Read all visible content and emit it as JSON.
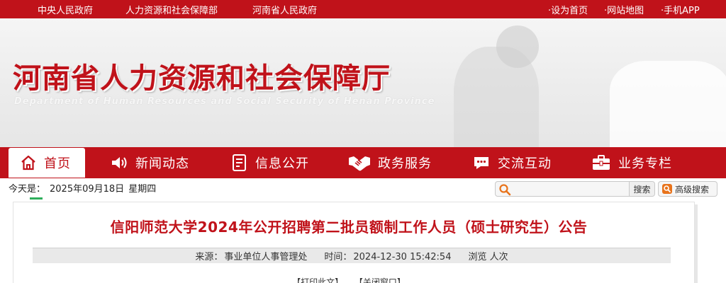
{
  "topbar": {
    "left_links": [
      "中央人民政府",
      "人力资源和社会保障部",
      "河南省人民政府"
    ],
    "right_links": [
      "·设为首页",
      "·网站地图",
      "·手机APP"
    ]
  },
  "banner": {
    "title": "河南省人力资源和社会保障厅",
    "subtitle": "Department of Human Resources and Social Security of Henan Province"
  },
  "nav": {
    "items": [
      {
        "label": "首页",
        "icon": "home-icon",
        "active": true
      },
      {
        "label": "新闻动态",
        "icon": "speaker-icon",
        "active": false
      },
      {
        "label": "信息公开",
        "icon": "document-icon",
        "active": false
      },
      {
        "label": "政务服务",
        "icon": "handshake-icon",
        "active": false
      },
      {
        "label": "交流互动",
        "icon": "chat-icon",
        "active": false
      },
      {
        "label": "业务专栏",
        "icon": "briefcase-icon",
        "active": false
      }
    ]
  },
  "today": {
    "label": "今天是：",
    "date": "2025年09月18日",
    "weekday": "星期四"
  },
  "search": {
    "placeholder": "",
    "button_label": "搜索",
    "advanced_label": "高级搜索"
  },
  "article": {
    "title": "信阳师范大学2024年公开招聘第二批员额制工作人员（硕士研究生）公告",
    "source_label": "来源：",
    "source_value": "事业单位人事管理处",
    "time_label": "时间：",
    "time_value": "2024-12-30 15:42:54",
    "views_label": "浏览",
    "views_suffix": "人次",
    "print_label": "【打印此文】",
    "close_label": "【关闭窗口】"
  },
  "colors": {
    "brand_red": "#c0121a",
    "accent_green": "#2fae5b"
  }
}
